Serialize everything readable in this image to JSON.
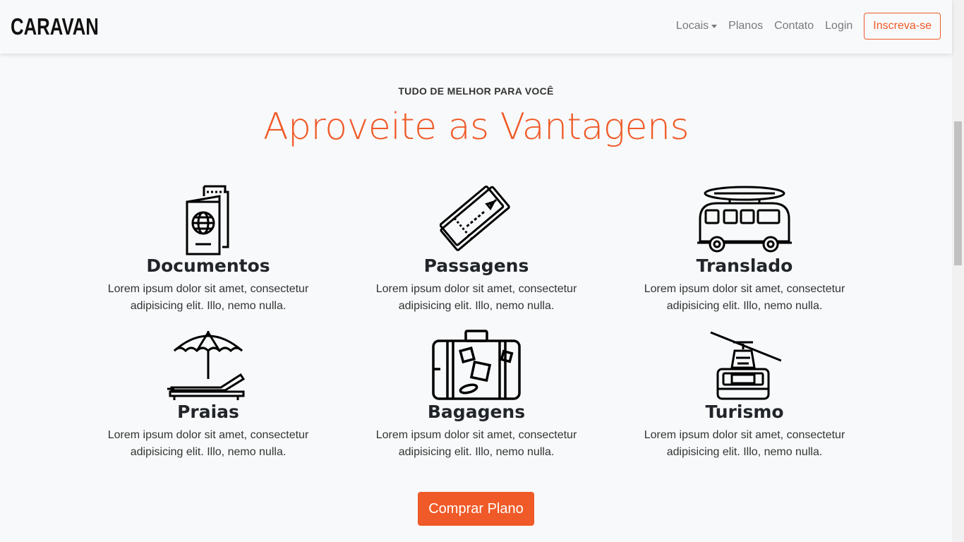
{
  "brand": "CARAVAN",
  "nav": {
    "locais": "Locais",
    "planos": "Planos",
    "contato": "Contato",
    "login": "Login",
    "signup": "Inscreva-se"
  },
  "section": {
    "eyebrow": "TUDO DE MELHOR PARA VOCÊ",
    "title": "Aproveite as Vantagens"
  },
  "features": [
    {
      "icon": "passport-icon",
      "title": "Documentos",
      "text": "Lorem ipsum dolor sit amet, consectetur adipisicing elit. Illo, nemo nulla."
    },
    {
      "icon": "ticket-icon",
      "title": "Passagens",
      "text": "Lorem ipsum dolor sit amet, consectetur adipisicing elit. Illo, nemo nulla."
    },
    {
      "icon": "van-icon",
      "title": "Translado",
      "text": "Lorem ipsum dolor sit amet, consectetur adipisicing elit. Illo, nemo nulla."
    },
    {
      "icon": "beach-umbrella-icon",
      "title": "Praias",
      "text": "Lorem ipsum dolor sit amet, consectetur adipisicing elit. Illo, nemo nulla."
    },
    {
      "icon": "suitcase-icon",
      "title": "Bagagens",
      "text": "Lorem ipsum dolor sit amet, consectetur adipisicing elit. Illo, nemo nulla."
    },
    {
      "icon": "cable-car-icon",
      "title": "Turismo",
      "text": "Lorem ipsum dolor sit amet, consectetur adipisicing elit. Illo, nemo nulla."
    }
  ],
  "cta": "Comprar Plano",
  "colors": {
    "accent": "#f05a28",
    "background": "#f8f9fa"
  }
}
